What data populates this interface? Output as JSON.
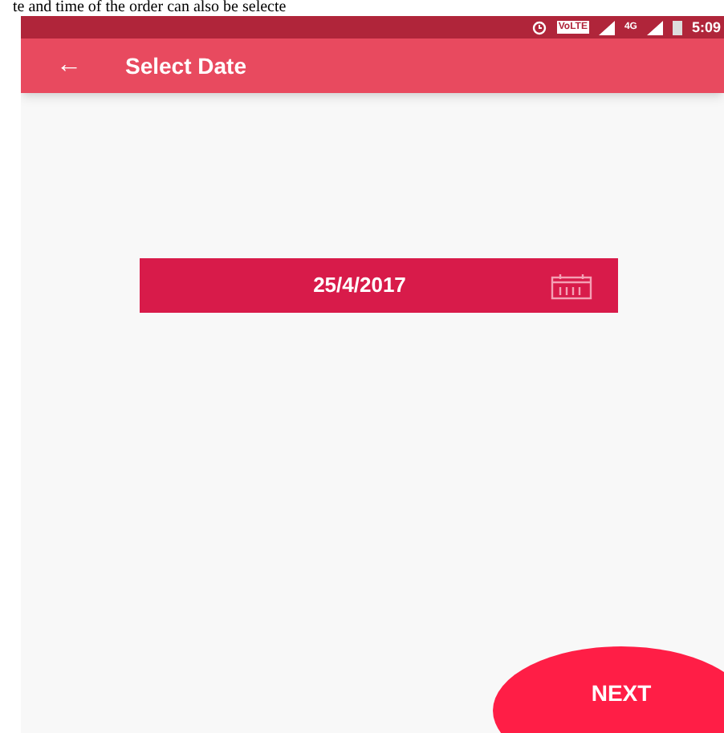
{
  "document_text": "te and time of the order can also be selecte",
  "status_bar": {
    "volte": "VoLTE",
    "network": "4G",
    "time": "5:09"
  },
  "toolbar": {
    "back": "←",
    "title": "Select Date"
  },
  "date_field": {
    "value": "25/4/2017"
  },
  "next_button": {
    "label": "NEXT"
  }
}
